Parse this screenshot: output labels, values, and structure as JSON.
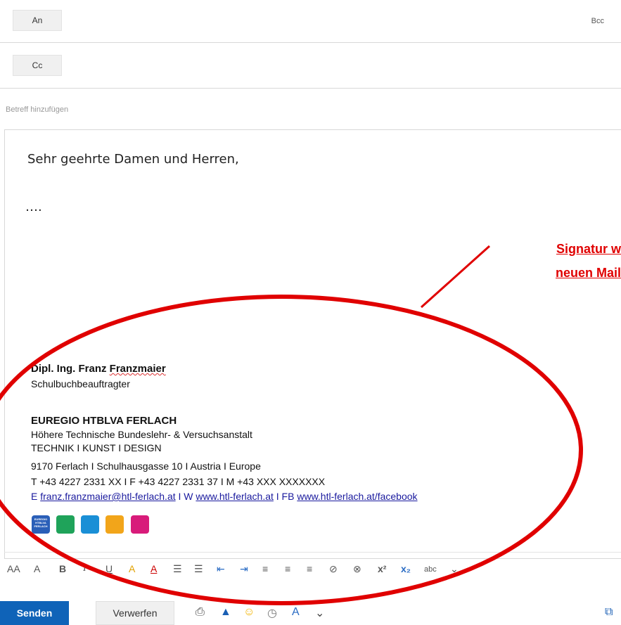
{
  "header": {
    "to_label": "An",
    "cc_label": "Cc",
    "bcc_label": "Bcc",
    "subject_placeholder": "Betreff hinzufügen"
  },
  "body": {
    "greeting": "Sehr geehrte Damen und Herren,",
    "ellipsis": "….",
    "annotation_line1": "Signatur w",
    "annotation_line2": "neuen Mail"
  },
  "signature": {
    "name_prefix": "Dipl. Ing. Franz ",
    "name_last": "Franzmaier",
    "role": "Schulbuchbeauftragter",
    "org": "EUREGIO HTBLVA FERLACH",
    "org_desc": "Höhere Technische Bundeslehr- & Versuchsanstalt",
    "motto": "TECHNIK I KUNST I DESIGN",
    "address": "9170 Ferlach I Schulhausgasse 10 I Austria I Europe",
    "phones": "T +43 4227 2331 XX I F +43 4227 2331 37 I M +43 XXX XXXXXXX",
    "email_label": "E ",
    "email": "franz.franzmaier@htl-ferlach.at",
    "web_label": " I W ",
    "web": "www.htl-ferlach.at",
    "fb_label": " I FB ",
    "fb": "www.htl-ferlach.at/facebook",
    "logo_text": "EUREGIO HTBLVA FERLACH"
  },
  "format_toolbar": {
    "font_size": "AA",
    "grow": "A",
    "bold": "B",
    "italic": "I",
    "underline": "U",
    "highlight": "A",
    "font_color": "A",
    "superscript": "x²",
    "subscript": "x₂",
    "strike": "abc"
  },
  "actions": {
    "send": "Senden",
    "discard": "Verwerfen"
  },
  "colors": {
    "accent": "#0f63b8",
    "annotation": "#e00000",
    "link": "#1a1a9e"
  }
}
